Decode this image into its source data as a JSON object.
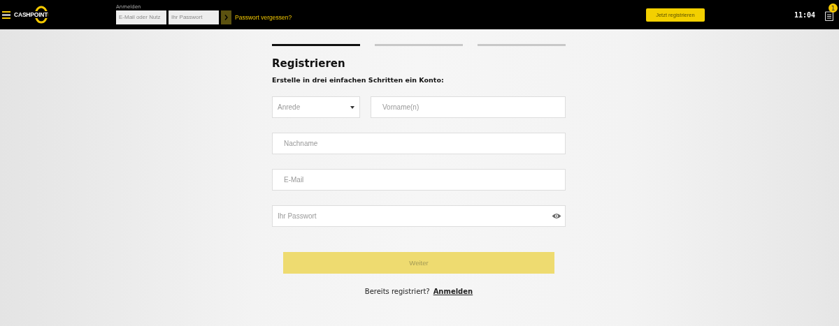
{
  "header": {
    "logo": "CASHPOINT",
    "login": {
      "label": "Anmelden",
      "username_placeholder": "E-Mail oder Nutz",
      "password_placeholder": "Ihr Passwort",
      "forgot_link": "Passwort vergessen?"
    },
    "register_button": "Jetzt registrieren",
    "clock": "11:04",
    "notification_count": "1"
  },
  "steps": [
    {
      "selected": true
    },
    {
      "selected": false
    },
    {
      "selected": false
    }
  ],
  "form": {
    "title": "Registrieren",
    "subtitle": "Erstelle in drei einfachen Schritten ein Konto:",
    "fields": [
      {
        "kind": "select",
        "placeholder": "Anrede"
      },
      {
        "kind": "text",
        "placeholder": "Vorname(n)"
      },
      {
        "kind": "text",
        "placeholder": "Nachname"
      },
      {
        "kind": "text",
        "placeholder": "E-Mail"
      },
      {
        "kind": "password",
        "placeholder": "Ihr Passwort"
      }
    ],
    "submit": {
      "label": "Weiter",
      "disabled": true
    },
    "footer_text": "Bereits registriert?",
    "footer_link": "Anmelden"
  }
}
